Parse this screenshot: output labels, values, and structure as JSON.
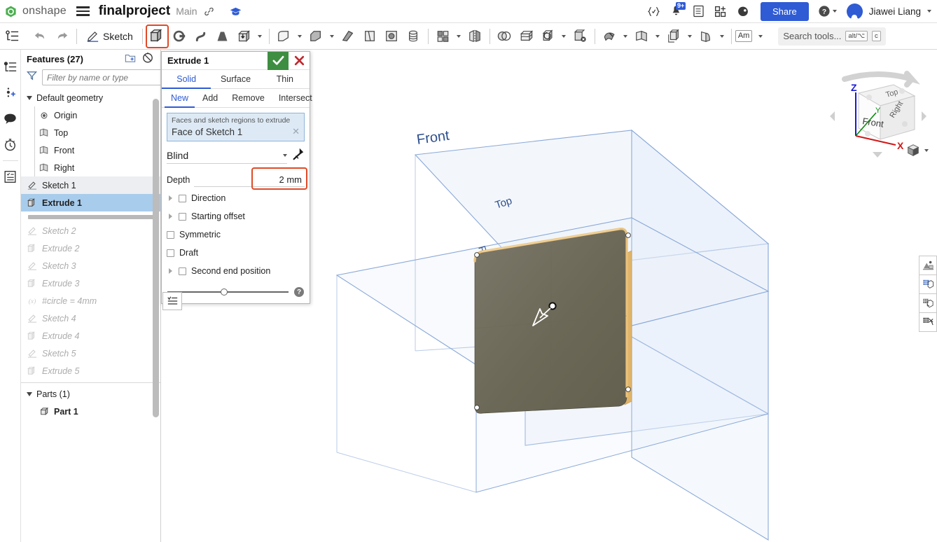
{
  "header": {
    "brand": "onshape",
    "brand_logo_icon": "onshape-logo-icon",
    "menu_icon": "hamburger-menu-icon",
    "document_title": "finalproject",
    "branch": "Main",
    "link_icon": "link-icon",
    "learning_icon": "graduation-cap-icon",
    "variables_icon": "variables-braces-icon",
    "notifications_icon": "bell-icon",
    "notifications_badge": "9+",
    "tasks_icon": "checklist-icon",
    "apps_icon": "apps-grid-icon",
    "ai_icon": "brain-icon",
    "share_label": "Share",
    "help_icon": "question-circle-icon",
    "avatar_icon": "user-avatar",
    "user_name": "Jiawei Liang"
  },
  "toolbar": {
    "feature_list_icon": "feature-list-icon",
    "undo_icon": "undo-arrow-icon",
    "redo_icon": "redo-arrow-icon",
    "sketch_label": "Sketch",
    "sketch_icon": "pencil-sketch-icon",
    "tools": [
      {
        "name": "extrude-tool",
        "icon": "extrude-icon",
        "highlighted": true
      },
      {
        "name": "revolve-tool",
        "icon": "revolve-icon",
        "highlighted": false
      },
      {
        "name": "sweep-tool",
        "icon": "sweep-icon",
        "highlighted": false
      },
      {
        "name": "loft-tool",
        "icon": "loft-icon",
        "highlighted": false
      },
      {
        "name": "thicken-tool",
        "icon": "thicken-box-icon",
        "highlighted": false
      }
    ],
    "tools2": [
      {
        "name": "fillet-tool",
        "icon": "fillet-icon"
      },
      {
        "name": "chamfer-tool",
        "icon": "chamfer-icon"
      },
      {
        "name": "rib-tool",
        "icon": "rib-icon"
      },
      {
        "name": "draft-tool",
        "icon": "draft-icon"
      },
      {
        "name": "shell-tool",
        "icon": "shell-icon"
      },
      {
        "name": "hole-tool",
        "icon": "hole-icon"
      }
    ],
    "tools3": [
      {
        "name": "pattern-tool",
        "icon": "pattern-grid-icon"
      },
      {
        "name": "mirror-tool",
        "icon": "mirror-icon"
      }
    ],
    "tools4": [
      {
        "name": "boolean-tool",
        "icon": "boolean-circles-icon"
      },
      {
        "name": "split-tool",
        "icon": "split-icon"
      },
      {
        "name": "transform-tool",
        "icon": "transform-icon"
      },
      {
        "name": "delete-face-tool",
        "icon": "delete-face-icon"
      }
    ],
    "tools5": [
      {
        "name": "sheet-metal-tool",
        "icon": "sheet-metal-icon"
      },
      {
        "name": "plane-tool",
        "icon": "plane-icon"
      },
      {
        "name": "derive-tool",
        "icon": "derive-icon"
      },
      {
        "name": "curve-tool",
        "icon": "curve-icon"
      }
    ],
    "units_label": "Am",
    "search_placeholder": "Search tools...",
    "search_kbd_1": "alt/⌥",
    "search_kbd_2": "c"
  },
  "rail": {
    "items": [
      {
        "name": "feature-tree-icon",
        "label": "Feature list"
      },
      {
        "name": "add-variable-icon",
        "label": "Variables"
      },
      {
        "name": "comment-icon",
        "label": "Comments"
      },
      {
        "name": "history-clock-icon",
        "label": "History"
      },
      {
        "name": "notes-list-icon",
        "label": "Notes"
      }
    ]
  },
  "features_panel": {
    "title": "Features (27)",
    "new_folder_icon": "new-folder-icon",
    "suppress_icon": "suppress-circle-slash-icon",
    "filter_icon": "funnel-filter-icon",
    "filter_placeholder": "Filter by name or type",
    "default_geometry_label": "Default geometry",
    "default_geometry": [
      {
        "label": "Origin",
        "icon": "origin-point-icon"
      },
      {
        "label": "Top",
        "icon": "plane-icon"
      },
      {
        "label": "Front",
        "icon": "plane-icon"
      },
      {
        "label": "Right",
        "icon": "plane-icon"
      }
    ],
    "active_features": [
      {
        "label": "Sketch 1",
        "icon": "sketch-pencil-icon",
        "state": "sel-soft"
      },
      {
        "label": "Extrude 1",
        "icon": "extrude-feature-icon",
        "state": "sel"
      }
    ],
    "rolled_back": [
      {
        "label": "Sketch 2",
        "icon": "sketch-pencil-icon"
      },
      {
        "label": "Extrude 2",
        "icon": "extrude-feature-icon"
      },
      {
        "label": "Sketch 3",
        "icon": "sketch-pencil-icon"
      },
      {
        "label": "Extrude 3",
        "icon": "extrude-feature-icon"
      },
      {
        "label": "#circle = 4mm",
        "icon": "variable-fx-icon"
      },
      {
        "label": "Sketch 4",
        "icon": "sketch-pencil-icon"
      },
      {
        "label": "Extrude 4",
        "icon": "extrude-feature-icon"
      },
      {
        "label": "Sketch 5",
        "icon": "sketch-pencil-icon"
      },
      {
        "label": "Extrude 5",
        "icon": "extrude-feature-icon"
      }
    ],
    "parts_label": "Parts (1)",
    "parts": [
      {
        "label": "Part 1",
        "icon": "part-solid-icon"
      }
    ]
  },
  "extrude_dialog": {
    "title": "Extrude 1",
    "confirm_icon": "check-icon",
    "cancel_icon": "x-icon",
    "type_tabs": [
      {
        "label": "Solid",
        "active": true
      },
      {
        "label": "Surface",
        "active": false
      },
      {
        "label": "Thin",
        "active": false
      }
    ],
    "op_tabs": [
      {
        "label": "New",
        "active": true
      },
      {
        "label": "Add",
        "active": false
      },
      {
        "label": "Remove",
        "active": false
      },
      {
        "label": "Intersect",
        "active": false
      }
    ],
    "selection_label": "Faces and sketch regions to extrude",
    "selection_value": "Face of Sketch 1",
    "selection_clear_icon": "x-small-icon",
    "end_condition": "Blind",
    "flip_icon": "flip-direction-icon",
    "depth_label": "Depth",
    "depth_value": "2 mm",
    "options": [
      {
        "label": "Direction",
        "expandable": true,
        "checked": false
      },
      {
        "label": "Starting offset",
        "expandable": true,
        "checked": false
      },
      {
        "label": "Symmetric",
        "expandable": false,
        "checked": false
      },
      {
        "label": "Draft",
        "expandable": false,
        "checked": false
      },
      {
        "label": "Second end position",
        "expandable": true,
        "checked": false
      }
    ],
    "help_icon": "help-question-icon",
    "side_button_icon": "selection-list-icon"
  },
  "viewport": {
    "plane_labels": [
      {
        "text": "Front"
      },
      {
        "text": "Top"
      },
      {
        "text": "Right"
      }
    ],
    "manipulator_icon": "direction-arrow-handle",
    "viewcube": {
      "top_label": "Top",
      "front_label": "Front",
      "right_label": "Right",
      "axis_z": "Z",
      "axis_y": "Y",
      "axis_x": "X",
      "axis_z_color": "#1a1ad0",
      "axis_y_color": "#0a8a0a",
      "axis_x_color": "#d01a1a"
    },
    "view_style_icon": "view-cube-style-icon",
    "right_tools": [
      {
        "name": "render-studio-icon"
      },
      {
        "name": "display-grid-icon"
      },
      {
        "name": "section-view-icon"
      },
      {
        "name": "measure-icon"
      }
    ]
  },
  "colors": {
    "accent_blue": "#2f5bd4",
    "annotation_red": "#e04a28",
    "confirm_green": "#3e8e41",
    "cancel_red": "#c0272d",
    "selection_blue": "#a8ccec",
    "plane_stroke": "#8aa8d8",
    "part_fill": "#6e6a55",
    "part_edge": "#e8c077"
  }
}
